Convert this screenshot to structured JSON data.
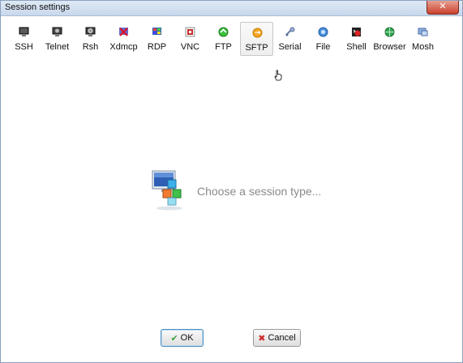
{
  "window": {
    "title": "Session settings"
  },
  "session_types": [
    {
      "label": "SSH",
      "icon": "ssh-icon"
    },
    {
      "label": "Telnet",
      "icon": "telnet-icon"
    },
    {
      "label": "Rsh",
      "icon": "rsh-icon"
    },
    {
      "label": "Xdmcp",
      "icon": "xdmcp-icon"
    },
    {
      "label": "RDP",
      "icon": "rdp-icon"
    },
    {
      "label": "VNC",
      "icon": "vnc-icon"
    },
    {
      "label": "FTP",
      "icon": "ftp-icon"
    },
    {
      "label": "SFTP",
      "icon": "sftp-icon",
      "selected": true
    },
    {
      "label": "Serial",
      "icon": "serial-icon"
    },
    {
      "label": "File",
      "icon": "file-icon"
    },
    {
      "label": "Shell",
      "icon": "shell-icon"
    },
    {
      "label": "Browser",
      "icon": "browser-icon"
    },
    {
      "label": "Mosh",
      "icon": "mosh-icon"
    }
  ],
  "main": {
    "prompt": "Choose a session type..."
  },
  "buttons": {
    "ok_label": "OK",
    "cancel_label": "Cancel"
  },
  "colors": {
    "accent": "#4f8fbf",
    "prompt_text": "#8a8a8a",
    "close_button": "#c9402c"
  }
}
